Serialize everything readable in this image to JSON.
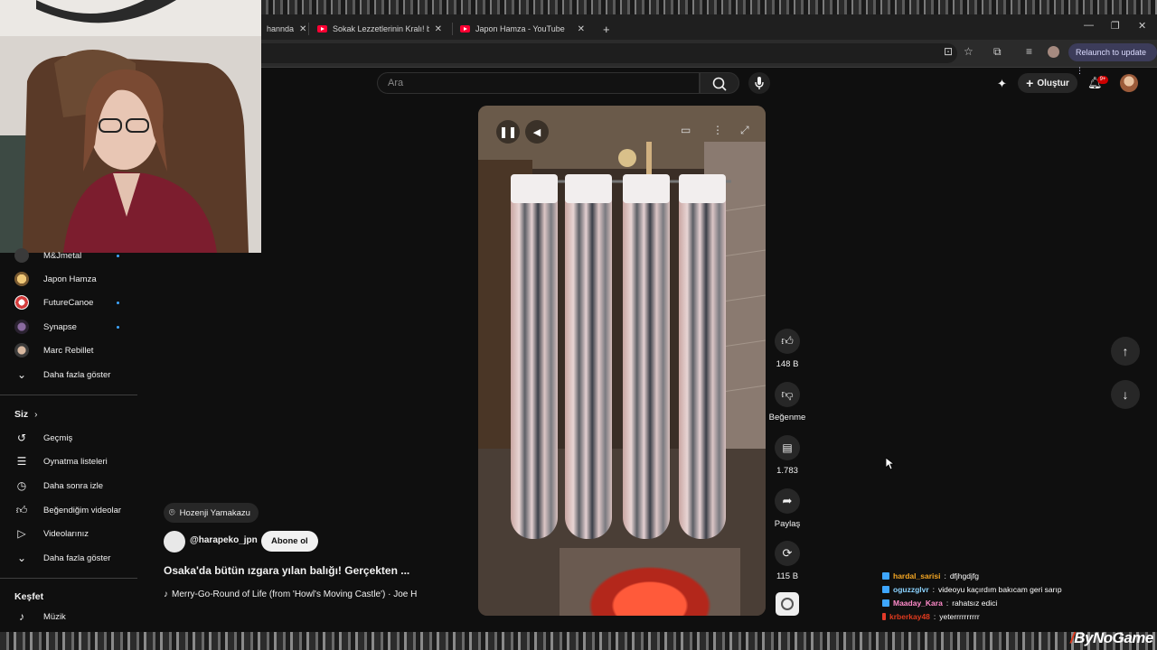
{
  "browser": {
    "tabs": [
      {
        "title": "hannda",
        "icon": "youtube-icon"
      },
      {
        "title": "Sokak Lezzetlerinin Kralı! bahan",
        "icon": "youtube-icon"
      },
      {
        "title": "Japon Hamza - YouTube",
        "icon": "youtube-icon"
      }
    ],
    "new_tab": "+",
    "relaunch_label": "Relaunch to update"
  },
  "header": {
    "search_placeholder": "Ara",
    "create_label": "Oluştur",
    "notification_count": "9+"
  },
  "sidebar": {
    "subscriptions": [
      {
        "label": "M&Jmetal",
        "new": true
      },
      {
        "label": "Japon Hamza",
        "new": false
      },
      {
        "label": "FutureCanoe",
        "new": true
      },
      {
        "label": "Synapse",
        "new": true
      },
      {
        "label": "Marc Rebillet",
        "new": false
      }
    ],
    "show_more_1": "Daha fazla göster",
    "you_heading": "Siz",
    "you_items": [
      {
        "label": "Geçmiş",
        "icon": "history-icon"
      },
      {
        "label": "Oynatma listeleri",
        "icon": "playlist-icon"
      },
      {
        "label": "Daha sonra izle",
        "icon": "watch-later-icon"
      },
      {
        "label": "Beğendiğim videolar",
        "icon": "like-icon"
      },
      {
        "label": "Videolarınız",
        "icon": "your-videos-icon"
      }
    ],
    "show_more_2": "Daha fazla göster",
    "explore_heading": "Keşfet",
    "explore_items": [
      {
        "label": "Müzik",
        "icon": "music-icon"
      }
    ]
  },
  "short": {
    "location": "Hozenji Yamakazu",
    "channel_handle": "@harapeko_jpn",
    "subscribe_label": "Abone ol",
    "title": "Osaka'da bütün ızgara yılan balığı! Gerçekten ...",
    "music": "Merry-Go-Round of Life (from 'Howl's Moving Castle') · Joe H",
    "actions": {
      "likes": "148 B",
      "dislike_label": "Beğenme",
      "comments": "1.783",
      "share_label": "Paylaş",
      "remixes": "115 B"
    }
  },
  "chat": [
    {
      "user": "hardal_sarisi",
      "message": "dfjhgdjfg",
      "user_color": "#f5a623",
      "badge": "blue"
    },
    {
      "user": "oguzzglvr",
      "message": "videoyu kaçırdım bakıcam geri sarıp",
      "user_color": "#8bd3ff",
      "badge": "blue"
    },
    {
      "user": "Maaday_Kara",
      "message": "rahatsız edici",
      "user_color": "#ff8ac9",
      "badge": "blue"
    },
    {
      "user": "krberkay48",
      "message": "yeterrrrrrrrrr",
      "user_color": "#e03a1e",
      "badge": "red"
    }
  ],
  "watermark": {
    "brand": "ByNoGame"
  }
}
